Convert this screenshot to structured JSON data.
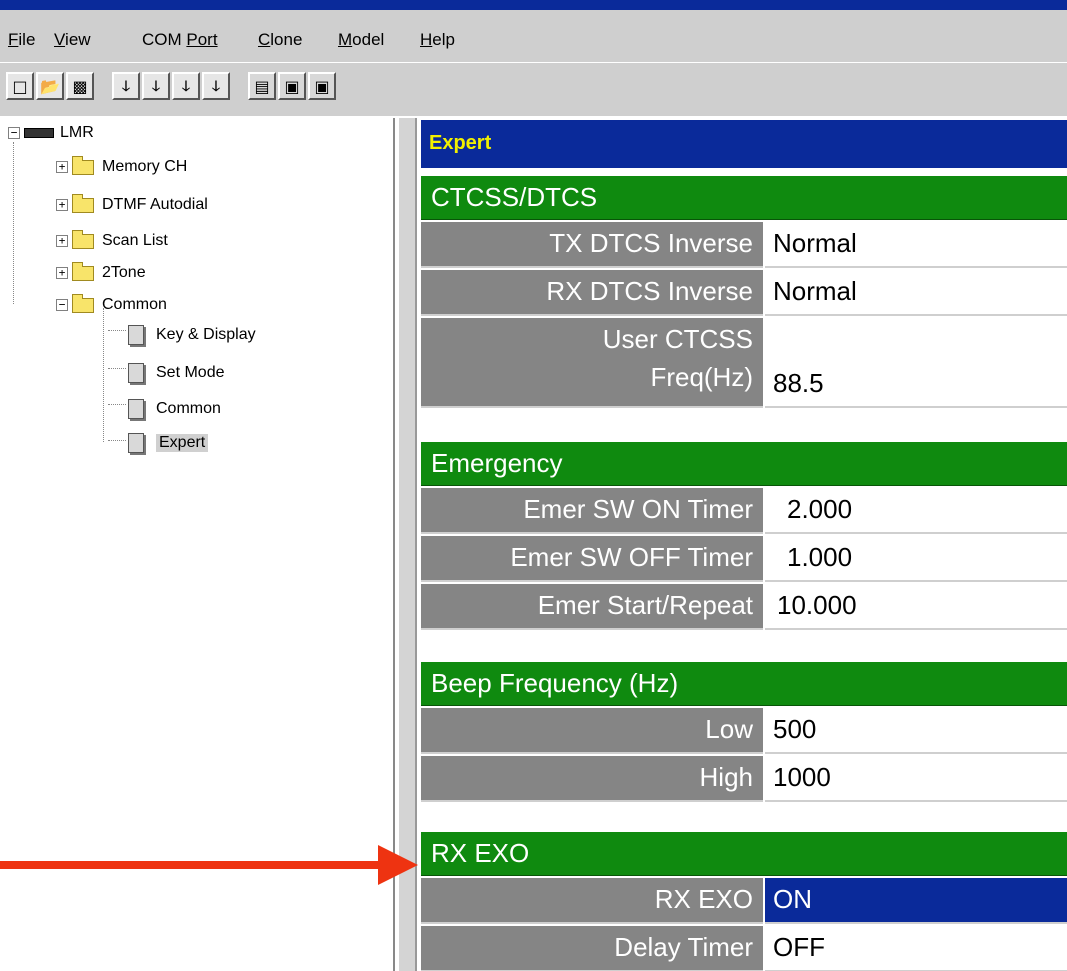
{
  "menu": {
    "items": [
      {
        "first": "F",
        "rest": "ile"
      },
      {
        "first": "V",
        "rest": "iew"
      },
      {
        "first": "COM ",
        "rest": "Port"
      },
      {
        "first": "C",
        "rest": "lone"
      },
      {
        "first": "M",
        "rest": "odel"
      },
      {
        "first": "H",
        "rest": "elp"
      }
    ]
  },
  "toolbar": {
    "buttons": [
      "new-icon",
      "open-icon",
      "save-icon",
      "clone-1-icon",
      "clone-2-icon",
      "clone-3-icon",
      "clone-4-icon",
      "read-icon",
      "write-radio-icon",
      "read-radio-icon"
    ]
  },
  "tree": {
    "root": "LMR",
    "folders": [
      "Memory CH",
      "DTMF Autodial",
      "Scan List",
      "2Tone",
      "Common"
    ],
    "common_children": [
      "Key & Display",
      "Set Mode",
      "Common",
      "Expert"
    ]
  },
  "panel": {
    "title": "Expert",
    "sections": [
      {
        "title": "CTCSS/DTCS",
        "rows": [
          {
            "label": "TX DTCS Inverse",
            "value": "Normal"
          },
          {
            "label": "RX DTCS Inverse",
            "value": "Normal"
          },
          {
            "label_line1": "User CTCSS",
            "label_line2": "Freq(Hz)",
            "value": "88.5"
          }
        ]
      },
      {
        "title": "Emergency",
        "rows": [
          {
            "label": "Emer SW ON Timer",
            "value": "2.000"
          },
          {
            "label": "Emer SW OFF Timer",
            "value": "1.000"
          },
          {
            "label": "Emer Start/Repeat",
            "value": "10.000"
          }
        ]
      },
      {
        "title": "Beep Frequency (Hz)",
        "rows": [
          {
            "label": "Low",
            "value": "500"
          },
          {
            "label": "High",
            "value": "1000"
          }
        ]
      },
      {
        "title": "RX EXO",
        "rows": [
          {
            "label": "RX EXO",
            "value": "ON"
          },
          {
            "label": "Delay Timer",
            "value": "OFF"
          }
        ]
      }
    ]
  },
  "colors": {
    "title_bar": "#0a2a9a",
    "section_green": "#0f8a0f",
    "label_gray": "#858585",
    "arrow_red": "#ee3311",
    "title_text": "#f2f000"
  }
}
